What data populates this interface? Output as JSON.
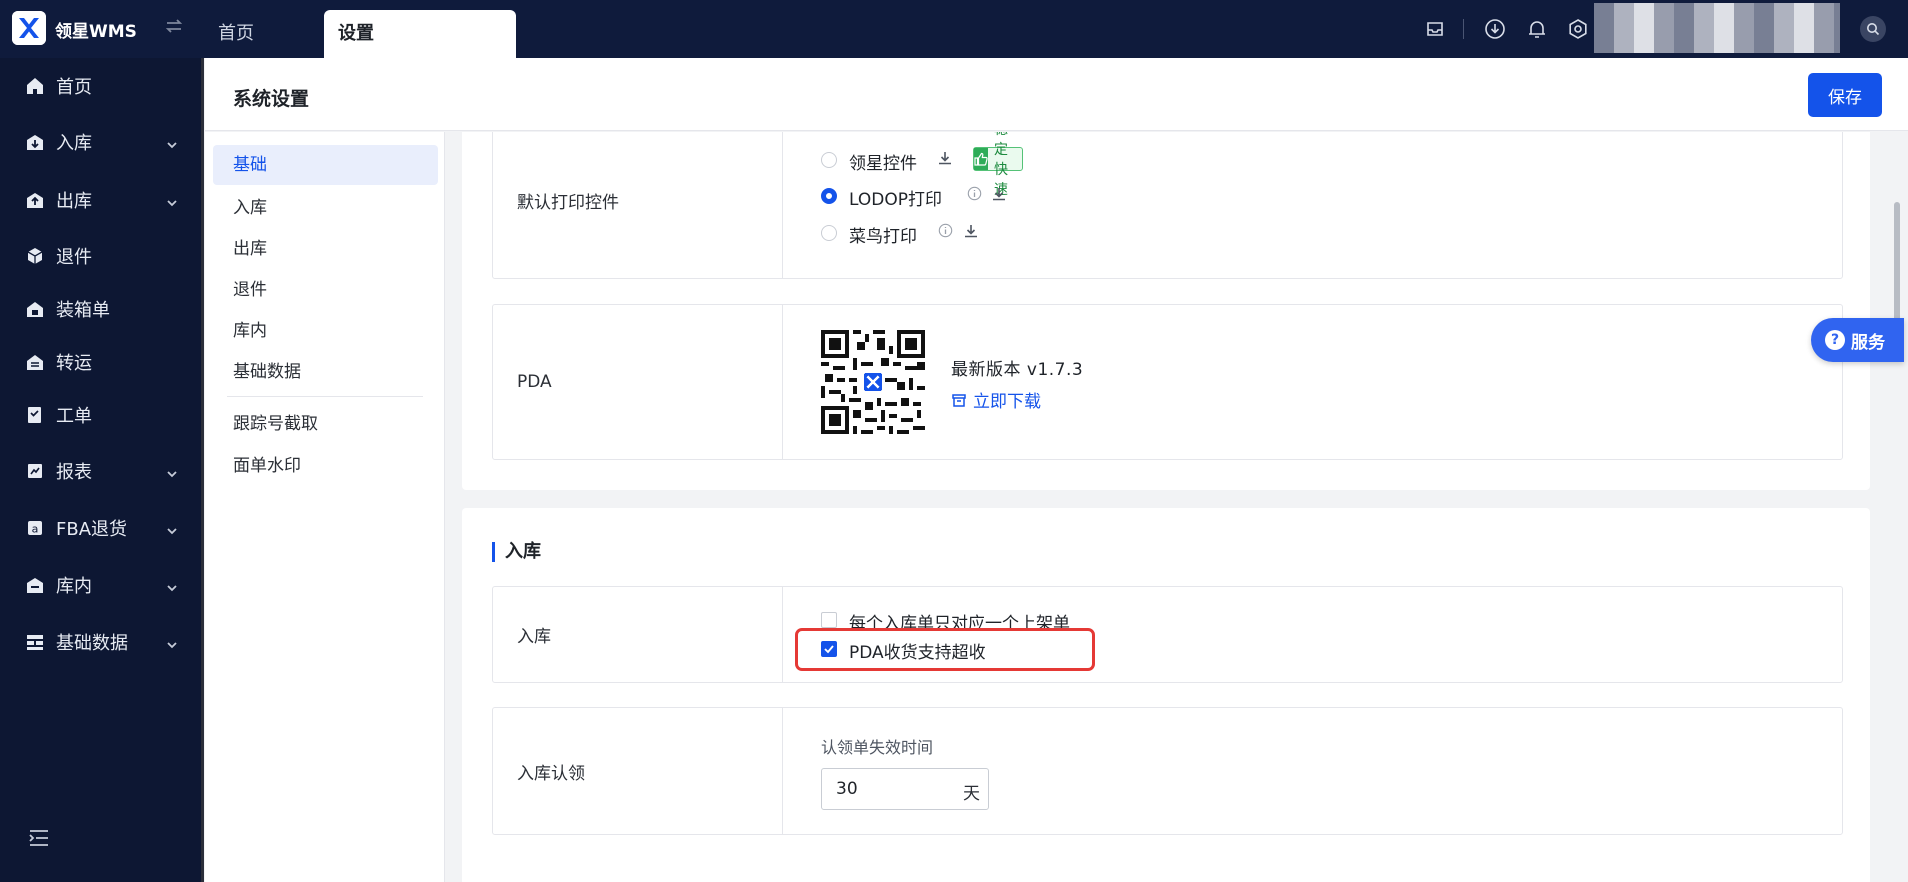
{
  "app": {
    "name": "领星WMS"
  },
  "topbar": {
    "tabs": [
      {
        "label": "首页"
      },
      {
        "label": "设置"
      }
    ]
  },
  "sidebar": {
    "items": [
      {
        "label": "首页",
        "icon": "home-icon",
        "has_submenu": false
      },
      {
        "label": "入库",
        "icon": "inbound-icon",
        "has_submenu": true
      },
      {
        "label": "出库",
        "icon": "outbound-icon",
        "has_submenu": true
      },
      {
        "label": "退件",
        "icon": "return-icon",
        "has_submenu": false
      },
      {
        "label": "装箱单",
        "icon": "packing-icon",
        "has_submenu": false
      },
      {
        "label": "转运",
        "icon": "transfer-icon",
        "has_submenu": false
      },
      {
        "label": "工单",
        "icon": "workorder-icon",
        "has_submenu": false
      },
      {
        "label": "报表",
        "icon": "report-icon",
        "has_submenu": true
      },
      {
        "label": "FBA退货",
        "icon": "amazon-icon",
        "has_submenu": true
      },
      {
        "label": "库内",
        "icon": "warehouse-icon",
        "has_submenu": true
      },
      {
        "label": "基础数据",
        "icon": "data-icon",
        "has_submenu": true
      }
    ]
  },
  "page": {
    "title": "系统设置",
    "save_label": "保存"
  },
  "submenu": {
    "items": [
      {
        "label": "基础",
        "active": true
      },
      {
        "label": "入库"
      },
      {
        "label": "出库"
      },
      {
        "label": "退件"
      },
      {
        "label": "库内"
      },
      {
        "label": "基础数据"
      },
      {
        "label": "跟踪号截取"
      },
      {
        "label": "面单水印"
      }
    ]
  },
  "basic": {
    "print_control": {
      "label": "默认打印控件",
      "options": [
        {
          "label": "领星控件",
          "selected": false
        },
        {
          "label": "LODOP打印",
          "selected": true
        },
        {
          "label": "菜鸟打印",
          "selected": false
        }
      ],
      "tag": "稳定快速"
    },
    "pda": {
      "label": "PDA",
      "version": "最新版本 v1.7.3",
      "download": "立即下载"
    }
  },
  "inbound": {
    "section_title": "入库",
    "settings": {
      "label": "入库",
      "options": [
        {
          "label": "每个入库单只对应一个上架单",
          "checked": false
        },
        {
          "label": "PDA收货支持超收",
          "checked": true
        }
      ]
    },
    "claim": {
      "label": "入库认领",
      "field_label": "认领单失效时间",
      "value": "30",
      "unit": "天"
    }
  },
  "service": {
    "label": "服务"
  },
  "colors": {
    "brand": "#1453ea",
    "topbar": "#0f1b3c",
    "sidebar": "#0d1733",
    "highlight": "#e53935",
    "tag_green": "#2eac58"
  }
}
